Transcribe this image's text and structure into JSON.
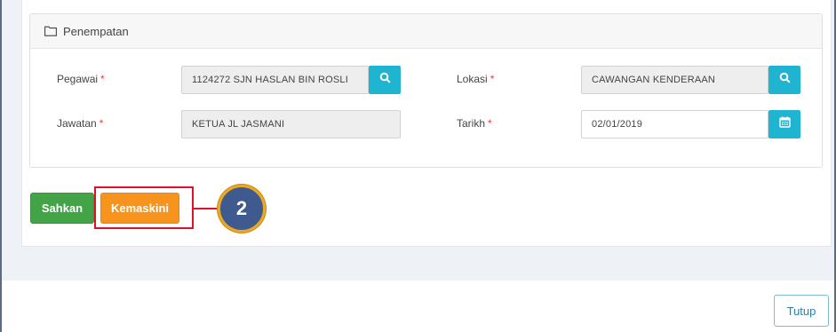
{
  "panel": {
    "title": "Penempatan",
    "title_icon": "folder-open-icon"
  },
  "form": {
    "pegawai": {
      "label": "Pegawai",
      "required": "*",
      "value": "1124272 SJN HASLAN BIN ROSLI",
      "action_icon": "search-icon"
    },
    "jawatan": {
      "label": "Jawatan",
      "required": "*",
      "value": "KETUA JL JASMANI"
    },
    "lokasi": {
      "label": "Lokasi",
      "required": "*",
      "value": "CAWANGAN KENDERAAN",
      "action_icon": "search-icon"
    },
    "tarikh": {
      "label": "Tarikh",
      "required": "*",
      "value": "02/01/2019",
      "action_icon": "calendar-icon"
    }
  },
  "actions": {
    "sahkan_label": "Sahkan",
    "kemaskini_label": "Kemaskini"
  },
  "annotation": {
    "step_number": "2",
    "highlight_color": "#e0102a",
    "badge_color": "#3f5a8e"
  },
  "footer": {
    "close_label": "Tutup"
  },
  "colors": {
    "success": "#43a447",
    "warning": "#f7941d",
    "info": "#1fb5d0",
    "required": "#e04040"
  }
}
